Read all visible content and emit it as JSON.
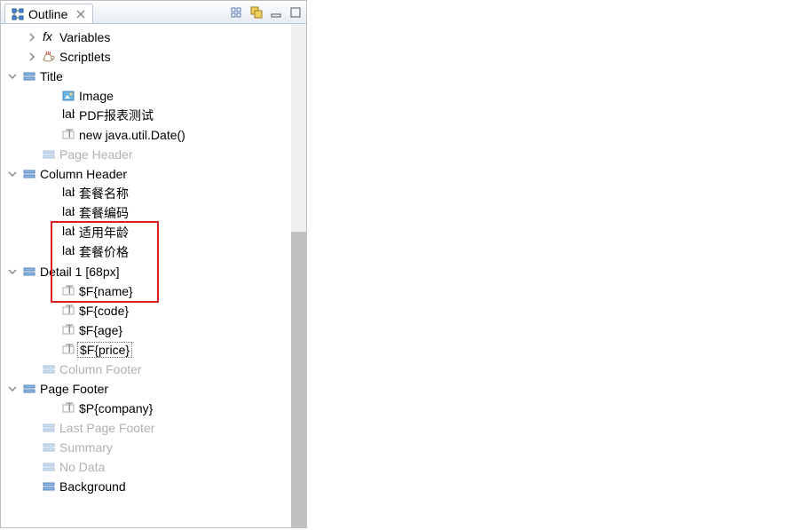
{
  "tab": {
    "title": "Outline",
    "close_tooltip": "Close"
  },
  "toolbar": {
    "btn1": "tree-mode-icon",
    "btn2": "view-icon",
    "btn3": "minimize-icon",
    "btn4": "maximize-icon"
  },
  "tree": {
    "variables": "Variables",
    "scriptlets": "Scriptlets",
    "title": "Title",
    "title_children": {
      "image": "Image",
      "label1": "PDF报表测试",
      "date": "new java.util.Date()"
    },
    "page_header": "Page Header",
    "column_header": "Column Header",
    "column_header_children": {
      "c1": "套餐名称",
      "c2": "套餐编码",
      "c3": "适用年龄",
      "c4": "套餐价格"
    },
    "detail": "Detail 1 [68px]",
    "detail_children": {
      "f1": "$F{name}",
      "f2": "$F{code}",
      "f3": "$F{age}",
      "f4": "$F{price}"
    },
    "column_footer": "Column Footer",
    "page_footer": "Page Footer",
    "page_footer_children": {
      "p1": "$P{company}"
    },
    "last_page_footer": "Last Page Footer",
    "summary": "Summary",
    "no_data": "No Data",
    "background": "Background"
  }
}
